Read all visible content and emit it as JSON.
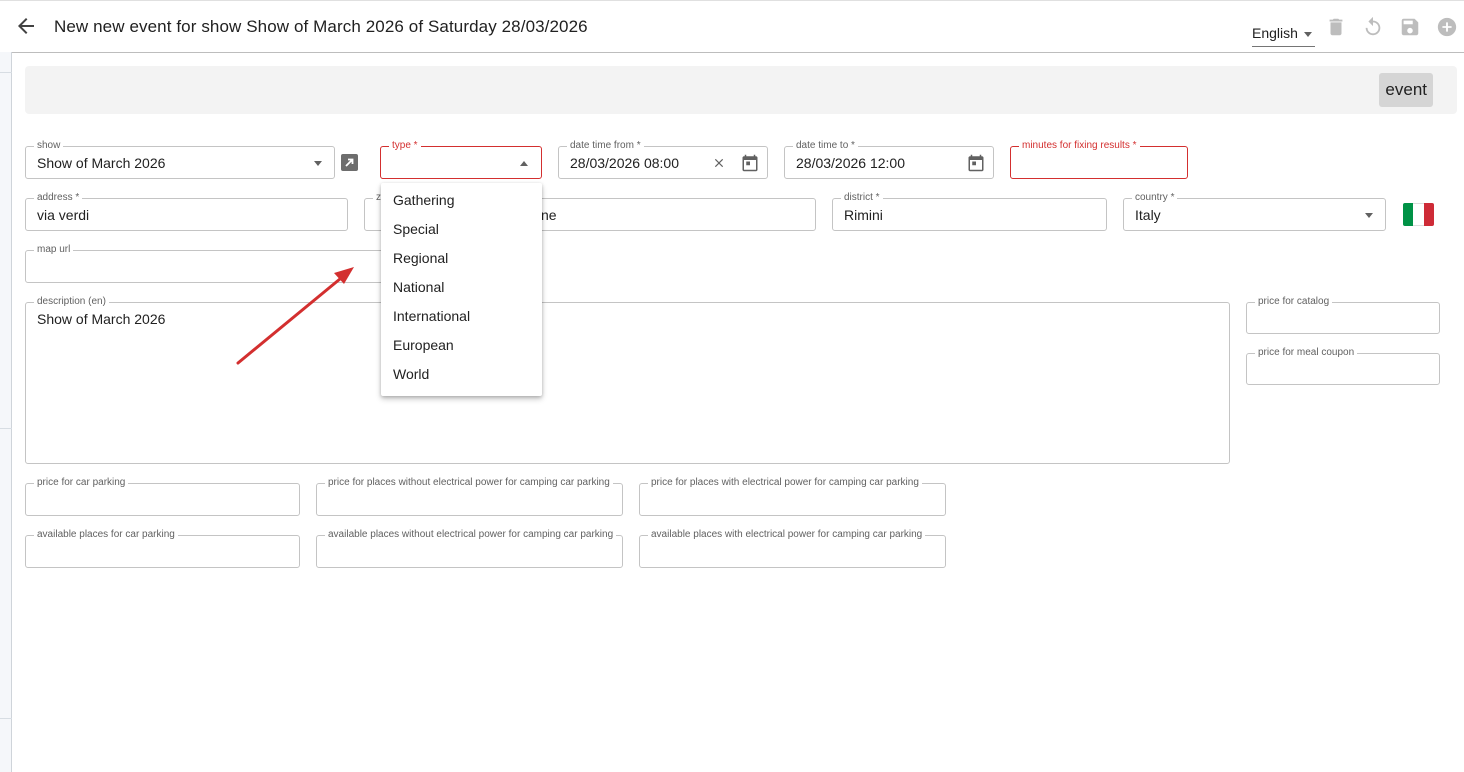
{
  "header": {
    "title": "New new event for show Show of March 2026 of Saturday 28/03/2026",
    "language": "English",
    "icons": [
      "back-arrow-icon",
      "trash-icon",
      "undo-icon",
      "save-icon",
      "add-circle-icon"
    ]
  },
  "panel": {
    "event_button": "event"
  },
  "form": {
    "show": {
      "label": "show",
      "value": "Show of March 2026"
    },
    "type": {
      "label": "type *",
      "value": ""
    },
    "date_from": {
      "label": "date time from *",
      "value": "28/03/2026 08:00"
    },
    "date_to": {
      "label": "date time to *",
      "value": "28/03/2026 12:00"
    },
    "minutes_fixing": {
      "label": "minutes for fixing results *",
      "value": ""
    },
    "address": {
      "label": "address *",
      "value": "via verdi"
    },
    "zip": {
      "label": "z",
      "value": ""
    },
    "city": {
      "label": "",
      "value": "ne"
    },
    "district": {
      "label": "district *",
      "value": "Rimini"
    },
    "country": {
      "label": "country *",
      "value": "Italy"
    },
    "map_url": {
      "label": "map url",
      "value": ""
    },
    "description": {
      "label": "description (en)",
      "value": "Show of March 2026"
    },
    "price_catalog": {
      "label": "price for catalog",
      "value": ""
    },
    "price_meal": {
      "label": "price for meal coupon",
      "value": ""
    },
    "price_car_parking": {
      "label": "price for car parking",
      "value": ""
    },
    "price_camping_no_power": {
      "label": "price for places without electrical power for camping car parking",
      "value": ""
    },
    "price_camping_power": {
      "label": "price for places with electrical power for camping car parking",
      "value": ""
    },
    "avail_car_parking": {
      "label": "available places for car parking",
      "value": ""
    },
    "avail_camping_no_power": {
      "label": "available places without electrical power for camping car parking",
      "value": ""
    },
    "avail_camping_power": {
      "label": "available places with electrical power for camping car parking",
      "value": ""
    }
  },
  "type_options": [
    "Gathering",
    "Special",
    "Regional",
    "National",
    "International",
    "European",
    "World"
  ],
  "colors": {
    "error": "#d32f2f",
    "annotation_arrow": "#d32f2f",
    "flag": [
      "#009246",
      "#ffffff",
      "#ce2b37"
    ]
  }
}
